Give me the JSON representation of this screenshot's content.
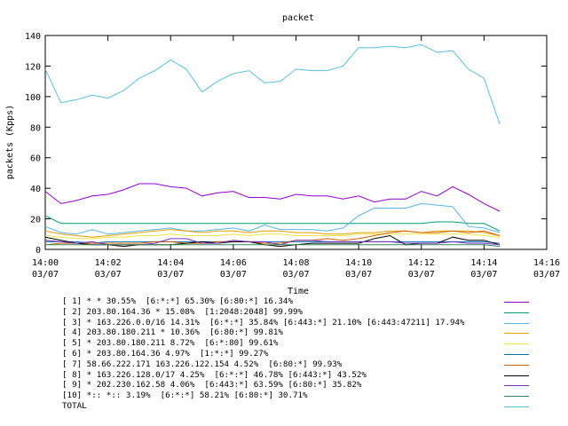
{
  "chart_data": {
    "type": "line",
    "title": "packet",
    "xlabel": "Time",
    "ylabel": "packets (Kpps)",
    "ylim": [
      0,
      140
    ],
    "yticks": [
      0,
      20,
      40,
      60,
      80,
      100,
      120,
      140
    ],
    "xlim": [
      "14:00",
      "14:16"
    ],
    "xticks": [
      {
        "time": "14:00",
        "date": "03/07"
      },
      {
        "time": "14:02",
        "date": "03/07"
      },
      {
        "time": "14:04",
        "date": "03/07"
      },
      {
        "time": "14:06",
        "date": "03/07"
      },
      {
        "time": "14:08",
        "date": "03/07"
      },
      {
        "time": "14:10",
        "date": "03/07"
      },
      {
        "time": "14:12",
        "date": "03/07"
      },
      {
        "time": "14:14",
        "date": "03/07"
      },
      {
        "time": "14:16",
        "date": "03/07"
      }
    ],
    "grid": false,
    "legend_placement": "bottom",
    "x": [
      "14:00",
      "14:00:30",
      "14:01",
      "14:01:30",
      "14:02",
      "14:02:30",
      "14:03",
      "14:03:30",
      "14:04",
      "14:04:30",
      "14:05",
      "14:05:30",
      "14:06",
      "14:06:30",
      "14:07",
      "14:07:30",
      "14:08",
      "14:08:30",
      "14:09",
      "14:09:30",
      "14:10",
      "14:10:30",
      "14:11",
      "14:11:30",
      "14:12",
      "14:12:30",
      "14:13",
      "14:13:30",
      "14:14",
      "14:14:30"
    ],
    "series": [
      {
        "name": "[ 1] * * 30.55%  [6:*:*] 65.30% [6:80:*] 16.34%",
        "color": "#9400d3",
        "values": [
          38,
          30,
          32,
          35,
          36,
          39,
          43,
          43,
          41,
          40,
          35,
          37,
          38,
          34,
          34,
          33,
          36,
          35,
          35,
          33,
          35,
          31,
          33,
          33,
          38,
          35,
          41,
          36,
          30,
          25
        ]
      },
      {
        "name": "[ 2] 203.80.164.36 * 15.08%  [1:2048:2048] 99.99%",
        "color": "#009e73",
        "values": [
          22,
          17,
          17,
          17,
          17,
          17,
          17,
          17,
          17,
          17,
          17,
          17,
          17,
          17,
          17,
          17,
          17,
          17,
          17,
          17,
          17,
          17,
          17,
          17,
          17,
          18,
          18,
          17,
          17,
          12
        ]
      },
      {
        "name": "[ 3] * 163.226.0.0/16 14.31%  [6:*:*] 35.84% [6:443:*] 21.10% [6:443:47211] 17.94%",
        "color": "#56b4e9",
        "values": [
          15,
          11,
          10,
          13,
          10,
          11,
          12,
          13,
          14,
          12,
          12,
          13,
          14,
          12,
          16,
          13,
          13,
          13,
          12,
          14,
          22,
          27,
          27,
          27,
          30,
          29,
          28,
          15,
          14,
          11
        ]
      },
      {
        "name": "[ 4] 203.80.180.211 * 10.36%  [6:80:*] 99.81%",
        "color": "#e69f00",
        "values": [
          12,
          10,
          9,
          8,
          9,
          10,
          11,
          12,
          13,
          12,
          11,
          12,
          12,
          11,
          12,
          12,
          11,
          11,
          10,
          10,
          11,
          11,
          12,
          12,
          11,
          12,
          12,
          12,
          11,
          9
        ]
      },
      {
        "name": "[ 5] * 203.80.180.211 8.72%  [6:*:80] 99.61%",
        "color": "#f0e442",
        "values": [
          9,
          8,
          7,
          7,
          8,
          8,
          9,
          9,
          10,
          9,
          9,
          9,
          10,
          9,
          10,
          10,
          9,
          9,
          9,
          9,
          10,
          10,
          10,
          10,
          10,
          10,
          10,
          10,
          9,
          8
        ]
      },
      {
        "name": "[ 6] * 203.80.164.36 4.97%  [1:*:*] 99.27%",
        "color": "#0072b2",
        "values": [
          5,
          5,
          5,
          4,
          5,
          5,
          5,
          5,
          5,
          5,
          5,
          5,
          5,
          5,
          5,
          5,
          5,
          5,
          5,
          5,
          5,
          5,
          5,
          5,
          5,
          5,
          5,
          5,
          5,
          4
        ]
      },
      {
        "name": "[ 7] 58.66.222.171 163.226.122.154 4.52%  [6:80:*] 99.93%",
        "color": "#d55e00",
        "values": [
          3,
          4,
          4,
          4,
          4,
          4,
          4,
          5,
          5,
          4,
          4,
          5,
          5,
          5,
          4,
          4,
          6,
          6,
          7,
          6,
          7,
          9,
          11,
          12,
          11,
          11,
          12,
          11,
          12,
          9
        ]
      },
      {
        "name": "[ 8] * 163.226.128.0/17 4.25%  [6:*:*] 46.78% [6:443:*] 43.52%",
        "color": "#000000",
        "values": [
          8,
          6,
          4,
          3,
          3,
          2,
          3,
          3,
          3,
          4,
          5,
          4,
          5,
          5,
          3,
          2,
          3,
          4,
          4,
          4,
          4,
          7,
          9,
          3,
          4,
          4,
          8,
          6,
          6,
          3
        ]
      },
      {
        "name": "[ 9] * 202.230.162.58 4.06%  [6:443:*] 63.59% [6:80:*] 35.82%",
        "color": "#7b2fbe",
        "values": [
          6,
          5,
          4,
          5,
          3,
          3,
          3,
          4,
          7,
          7,
          4,
          4,
          6,
          5,
          5,
          3,
          6,
          6,
          5,
          5,
          5,
          5,
          5,
          4,
          4,
          4,
          5,
          4,
          4,
          3
        ]
      },
      {
        "name": "[10] *:: *:: 3.19%  [6:*:*] 58.21% [6:80:*] 30.71%",
        "color": "#2e8b57",
        "values": [
          3,
          3,
          3,
          3,
          3,
          3,
          3,
          3,
          3,
          3,
          3,
          3,
          3,
          3,
          3,
          3,
          3,
          3,
          3,
          3,
          3,
          3,
          3,
          3,
          3,
          3,
          3,
          3,
          3,
          2
        ]
      },
      {
        "name": "TOTAL",
        "color": "#56c1e0",
        "values": [
          118,
          96,
          98,
          101,
          99,
          104,
          112,
          117,
          124,
          118,
          103,
          110,
          115,
          117,
          109,
          110,
          118,
          117,
          117,
          120,
          132,
          132,
          133,
          132,
          134,
          129,
          130,
          118,
          112,
          82
        ]
      }
    ]
  }
}
